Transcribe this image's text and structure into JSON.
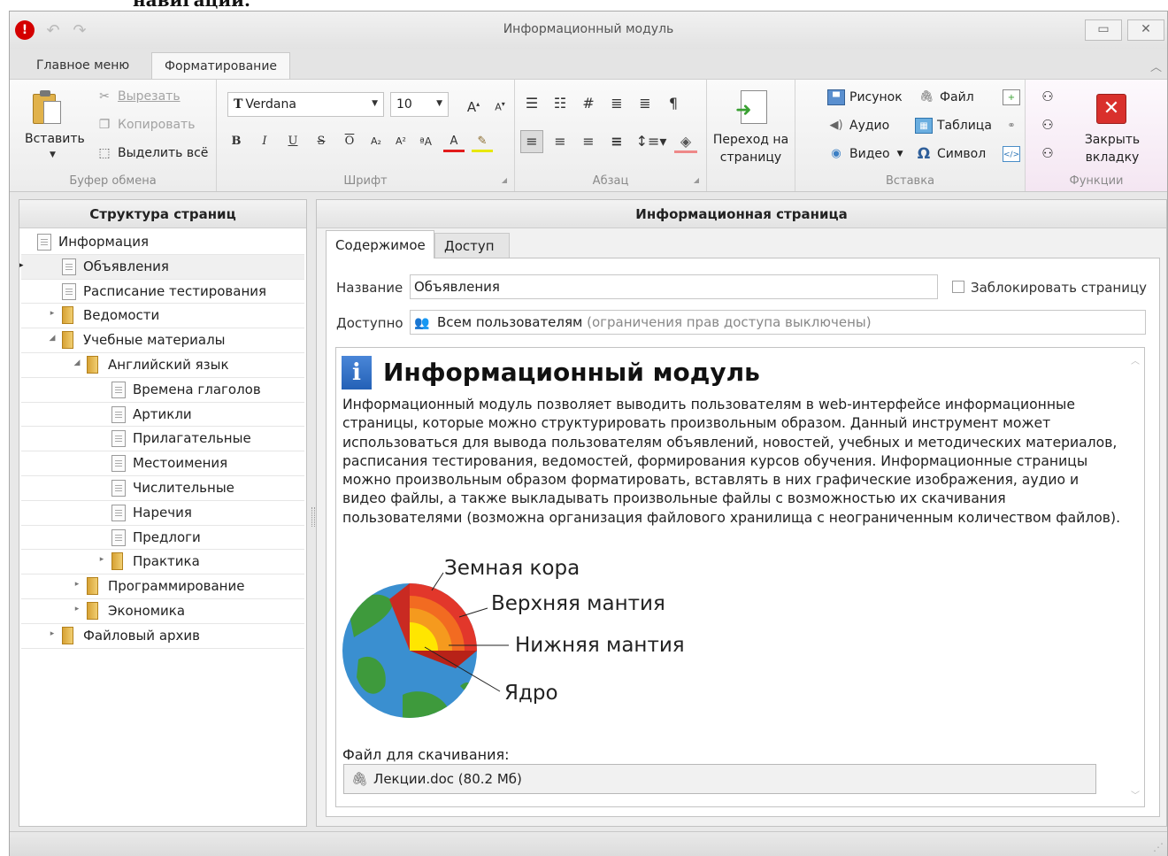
{
  "top_text": "навигации.",
  "window": {
    "title": "Информационный модуль"
  },
  "ribbon": {
    "tabs": [
      "Главное меню",
      "Форматирование"
    ],
    "active_tab": "Форматирование",
    "clipboard": {
      "label": "Буфер обмена",
      "paste": "Вставить",
      "cut": "Вырезать",
      "copy": "Копировать",
      "select_all": "Выделить всё"
    },
    "font": {
      "label": "Шрифт",
      "family": "Verdana",
      "size": "10",
      "grow_icon": "A",
      "shrink_icon": "A",
      "bold": "B",
      "italic": "I",
      "underline": "U",
      "strike": "S",
      "overline": "O",
      "subscript": "A₂",
      "superscript": "A²",
      "case": "ªA",
      "font_color": "A"
    },
    "paragraph": {
      "label": "Абзац"
    },
    "navigate": {
      "label_line1": "Переход на",
      "label_line2": "страницу"
    },
    "insert": {
      "label": "Вставка",
      "picture": "Рисунок",
      "audio": "Аудио",
      "video": "Видео",
      "file": "Файл",
      "table": "Таблица",
      "symbol": "Символ"
    },
    "functions": {
      "label": "Функции",
      "close_line1": "Закрыть",
      "close_line2": "вкладку"
    }
  },
  "left_panel": {
    "title": "Структура страниц",
    "tree": [
      {
        "label": "Информация",
        "level": 0,
        "type": "doc",
        "expander": "",
        "selected": false,
        "marker": ""
      },
      {
        "label": "Объявления",
        "level": 1,
        "type": "doc",
        "expander": "",
        "selected": true,
        "marker": "▸"
      },
      {
        "label": "Расписание тестирования",
        "level": 1,
        "type": "doc",
        "expander": "",
        "selected": false,
        "marker": ""
      },
      {
        "label": "Ведомости",
        "level": 1,
        "type": "folder",
        "expander": "▸",
        "selected": false,
        "marker": ""
      },
      {
        "label": "Учебные материалы",
        "level": 1,
        "type": "folder",
        "expander": "◢",
        "selected": false,
        "marker": ""
      },
      {
        "label": "Английский язык",
        "level": 2,
        "type": "folder",
        "expander": "◢",
        "selected": false,
        "marker": ""
      },
      {
        "label": "Времена глаголов",
        "level": 3,
        "type": "doc",
        "expander": "",
        "selected": false,
        "marker": ""
      },
      {
        "label": "Артикли",
        "level": 3,
        "type": "doc",
        "expander": "",
        "selected": false,
        "marker": ""
      },
      {
        "label": "Прилагательные",
        "level": 3,
        "type": "doc",
        "expander": "",
        "selected": false,
        "marker": ""
      },
      {
        "label": "Местоимения",
        "level": 3,
        "type": "doc",
        "expander": "",
        "selected": false,
        "marker": ""
      },
      {
        "label": "Числительные",
        "level": 3,
        "type": "doc",
        "expander": "",
        "selected": false,
        "marker": ""
      },
      {
        "label": "Наречия",
        "level": 3,
        "type": "doc",
        "expander": "",
        "selected": false,
        "marker": ""
      },
      {
        "label": "Предлоги",
        "level": 3,
        "type": "doc",
        "expander": "",
        "selected": false,
        "marker": ""
      },
      {
        "label": "Практика",
        "level": 3,
        "type": "folder",
        "expander": "▸",
        "selected": false,
        "marker": ""
      },
      {
        "label": "Программирование",
        "level": 2,
        "type": "folder",
        "expander": "▸",
        "selected": false,
        "marker": ""
      },
      {
        "label": "Экономика",
        "level": 2,
        "type": "folder",
        "expander": "▸",
        "selected": false,
        "marker": ""
      },
      {
        "label": "Файловый архив",
        "level": 1,
        "type": "folder",
        "expander": "▸",
        "selected": false,
        "marker": ""
      }
    ]
  },
  "right_panel": {
    "title": "Информационная страница",
    "tabs": [
      "Содержимое",
      "Доступ"
    ],
    "active_tab": "Содержимое",
    "name_label": "Название",
    "name_value": "Объявления",
    "lock_label": "Заблокировать страницу",
    "lock_checked": false,
    "access_label": "Доступно",
    "access_value": "Всем пользователям",
    "access_note": "(ограничения прав доступа выключены)",
    "document": {
      "title": "Информационный модуль",
      "body": "Информационный модуль позволяет выводить пользователям в web-интерфейсе информационные страницы, которые можно структурировать произвольным образом. Данный инструмент может использоваться для вывода пользователям объявлений, новостей, учебных и методических материалов, расписания тестирования, ведомостей, формирования курсов обучения. Информационные страницы можно произвольным образом форматировать, вставлять в них графические изображения, аудио и видео файлы, а также выкладывать произвольные файлы с возможностью их скачивания пользователями (возможна организация файлового хранилища с неограниченным количеством файлов).",
      "diagram_labels": {
        "crust": "Земная кора",
        "upper_mantle": "Верхняя мантия",
        "lower_mantle": "Нижняя мантия",
        "core": "Ядро"
      },
      "file_label": "Файл для скачивания:",
      "file_name": "Лекции.doc (80.2 Мб)"
    }
  },
  "colors": {
    "accent_red": "#d9302c",
    "earth_ocean": "#3a8fd0",
    "earth_land": "#3e9a3c",
    "crust": "#e2372b",
    "mantle": "#f59a1e",
    "core": "#ffe600"
  }
}
